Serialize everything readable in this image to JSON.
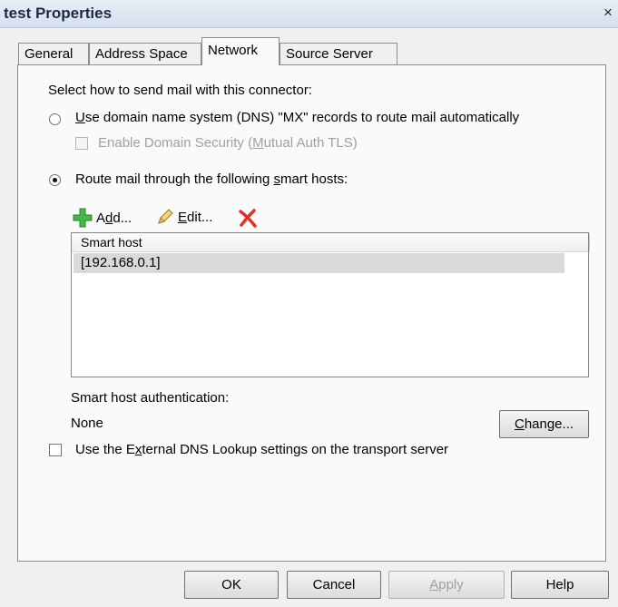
{
  "window": {
    "title": "test Properties",
    "close_glyph": "×"
  },
  "tabs": [
    {
      "label": "General",
      "active": false
    },
    {
      "label": "Address Space",
      "active": false
    },
    {
      "label": "Network",
      "active": true
    },
    {
      "label": "Source Server",
      "active": false
    }
  ],
  "network": {
    "intro": "Select how to send mail with this connector:",
    "option_dns": {
      "accel": "U",
      "rest": "se domain name system (DNS) \"MX\" records to route mail automatically",
      "selected": false
    },
    "domain_security": {
      "pre": "Enable Domain Security (",
      "accel": "M",
      "post": "utual Auth TLS)",
      "checked": false,
      "enabled": false
    },
    "option_smart": {
      "pre": "Route mail through the following ",
      "accel": "s",
      "post": "mart hosts:",
      "selected": true
    },
    "toolbar": {
      "add": {
        "pre": "A",
        "accel": "d",
        "post": "d...",
        "icon": "green-plus-icon"
      },
      "edit": {
        "accel": "E",
        "post": "dit...",
        "icon": "pencil-icon"
      },
      "remove": {
        "icon": "red-x-icon"
      }
    },
    "list": {
      "column": "Smart host",
      "rows": [
        "[192.168.0.1]"
      ]
    },
    "auth_label": "Smart host authentication:",
    "auth_value": "None",
    "change_button": {
      "accel": "C",
      "post": "hange..."
    },
    "external_dns": {
      "pre": "Use the E",
      "accel": "x",
      "post": "ternal DNS Lookup settings on the transport server",
      "checked": false
    }
  },
  "buttons": {
    "ok": "OK",
    "cancel": "Cancel",
    "apply": {
      "accel": "A",
      "post": "pply",
      "enabled": false
    },
    "help": "Help"
  },
  "colors": {
    "titlebar": "#d5dfee",
    "selected_row": "#d9d9d9",
    "remove_red": "#e0302a",
    "add_green": "#3cb043"
  }
}
